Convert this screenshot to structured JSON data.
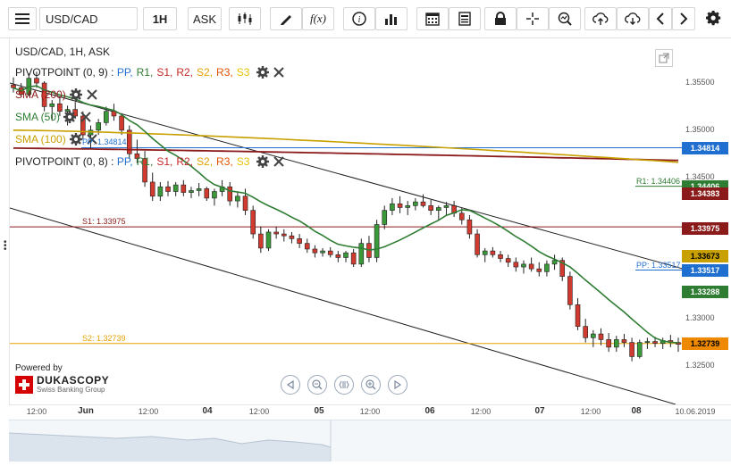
{
  "toolbar": {
    "symbol": "USD/CAD",
    "period": "1H",
    "side": "ASK"
  },
  "chart": {
    "title": "USD/CAD, 1H, ASK",
    "legend": [
      {
        "label": "PIVOTPOINT (0, 9)",
        "levels": [
          {
            "text": "PP,",
            "color": "#1f6fd1"
          },
          {
            "text": "R1,",
            "color": "#2e7d32"
          },
          {
            "text": "S1,",
            "color": "#c62828"
          },
          {
            "text": "R2,",
            "color": "#c62828"
          },
          {
            "text": "S2,",
            "color": "#e6a100"
          },
          {
            "text": "R3,",
            "color": "#e65100"
          },
          {
            "text": "S3",
            "color": "#e6c200"
          }
        ]
      },
      {
        "label": "SMA (200)",
        "color": "#8b1a1a"
      },
      {
        "label": "SMA (50)",
        "color": "#2e7d32"
      },
      {
        "label": "SMA (100)",
        "color": "#c8a000"
      },
      {
        "label": "PIVOTPOINT (0, 8)",
        "levels": [
          {
            "text": "PP,",
            "color": "#1f6fd1"
          },
          {
            "text": "R1,",
            "color": "#2e7d32"
          },
          {
            "text": "S1,",
            "color": "#c62828"
          },
          {
            "text": "R2,",
            "color": "#c62828"
          },
          {
            "text": "S2,",
            "color": "#e6a100"
          },
          {
            "text": "R3,",
            "color": "#e65100"
          },
          {
            "text": "S3",
            "color": "#e6c200"
          }
        ]
      }
    ],
    "line_labels": {
      "pp": "PP: 1.34814",
      "r1": "R1: 1.34406",
      "s1": "S1: 1.33975",
      "pp2": "PP: 1.33517",
      "s2": "S2: 1.32739"
    },
    "price_axis": [
      "1.35500",
      "1.35000",
      "1.34500",
      "1.33000",
      "1.32500"
    ],
    "price_tags": [
      {
        "text": "1.34814",
        "bg": "#1f6fd1",
        "fg": "#ffffff"
      },
      {
        "text": "1.34406",
        "bg": "#2e7d32",
        "fg": "#ffffff"
      },
      {
        "text": "1.34383",
        "bg": "#8b1a1a",
        "fg": "#ffffff"
      },
      {
        "text": "1.33975",
        "bg": "#8b1a1a",
        "fg": "#ffffff"
      },
      {
        "text": "1.33673",
        "bg": "#c8a000",
        "fg": "#000000"
      },
      {
        "text": "1.33517",
        "bg": "#1f6fd1",
        "fg": "#ffffff"
      },
      {
        "text": "1.33288",
        "bg": "#2e7d32",
        "fg": "#ffffff"
      },
      {
        "text": "1.32739",
        "bg": "#ef8a00",
        "fg": "#000000"
      }
    ],
    "time_axis": [
      {
        "text": "12:00",
        "bold": false
      },
      {
        "text": "Jun",
        "bold": true
      },
      {
        "text": "12:00",
        "bold": false
      },
      {
        "text": "04",
        "bold": true
      },
      {
        "text": "12:00",
        "bold": false
      },
      {
        "text": "05",
        "bold": true
      },
      {
        "text": "12:00",
        "bold": false
      },
      {
        "text": "06",
        "bold": true
      },
      {
        "text": "12:00",
        "bold": false
      },
      {
        "text": "07",
        "bold": true
      },
      {
        "text": "12:00",
        "bold": false
      },
      {
        "text": "08",
        "bold": true
      },
      {
        "text": "10.06.2019",
        "bold": false
      }
    ],
    "branding": {
      "powered_by": "Powered by",
      "name": "DUKASCOPY",
      "tagline": "Swiss Banking Group"
    },
    "candles": [
      [
        1.3548,
        1.3556,
        1.354,
        1.3545
      ],
      [
        1.3545,
        1.355,
        1.3535,
        1.3538
      ],
      [
        1.3538,
        1.356,
        1.3536,
        1.3555
      ],
      [
        1.3555,
        1.3562,
        1.3545,
        1.355
      ],
      [
        1.355,
        1.3552,
        1.352,
        1.3525
      ],
      [
        1.3525,
        1.3532,
        1.351,
        1.3528
      ],
      [
        1.3528,
        1.3535,
        1.3515,
        1.352
      ],
      [
        1.352,
        1.3526,
        1.3505,
        1.3522
      ],
      [
        1.3522,
        1.353,
        1.3512,
        1.3515
      ],
      [
        1.3515,
        1.352,
        1.349,
        1.3495
      ],
      [
        1.3495,
        1.3505,
        1.348,
        1.35
      ],
      [
        1.35,
        1.3512,
        1.3495,
        1.3508
      ],
      [
        1.3508,
        1.3525,
        1.3505,
        1.352
      ],
      [
        1.352,
        1.3528,
        1.351,
        1.3515
      ],
      [
        1.3515,
        1.3518,
        1.3495,
        1.35
      ],
      [
        1.35,
        1.3505,
        1.347,
        1.3475
      ],
      [
        1.3475,
        1.349,
        1.3465,
        1.347
      ],
      [
        1.347,
        1.3478,
        1.344,
        1.3445
      ],
      [
        1.3445,
        1.3455,
        1.3425,
        1.343
      ],
      [
        1.343,
        1.3445,
        1.3425,
        1.344
      ],
      [
        1.344,
        1.3446,
        1.343,
        1.3435
      ],
      [
        1.3435,
        1.3445,
        1.343,
        1.3442
      ],
      [
        1.3442,
        1.3447,
        1.343,
        1.3434
      ],
      [
        1.3434,
        1.344,
        1.3428,
        1.3436
      ],
      [
        1.3436,
        1.3444,
        1.343,
        1.3438
      ],
      [
        1.3438,
        1.344,
        1.3425,
        1.3428
      ],
      [
        1.3428,
        1.3438,
        1.342,
        1.3435
      ],
      [
        1.3435,
        1.3447,
        1.343,
        1.344
      ],
      [
        1.344,
        1.3445,
        1.342,
        1.3425
      ],
      [
        1.3425,
        1.3435,
        1.3418,
        1.343
      ],
      [
        1.343,
        1.3438,
        1.341,
        1.3415
      ],
      [
        1.3415,
        1.342,
        1.3385,
        1.339
      ],
      [
        1.339,
        1.3398,
        1.337,
        1.3375
      ],
      [
        1.3375,
        1.3395,
        1.3372,
        1.3392
      ],
      [
        1.3392,
        1.3398,
        1.3385,
        1.339
      ],
      [
        1.339,
        1.3395,
        1.3382,
        1.3388
      ],
      [
        1.3388,
        1.3392,
        1.338,
        1.3385
      ],
      [
        1.3385,
        1.339,
        1.3375,
        1.338
      ],
      [
        1.338,
        1.3385,
        1.337,
        1.3374
      ],
      [
        1.3374,
        1.3378,
        1.3365,
        1.337
      ],
      [
        1.337,
        1.3375,
        1.3366,
        1.3372
      ],
      [
        1.3372,
        1.3376,
        1.3365,
        1.3368
      ],
      [
        1.3368,
        1.3372,
        1.336,
        1.3365
      ],
      [
        1.3365,
        1.3372,
        1.336,
        1.337
      ],
      [
        1.337,
        1.3374,
        1.3355,
        1.3358
      ],
      [
        1.3358,
        1.3385,
        1.3355,
        1.338
      ],
      [
        1.338,
        1.3388,
        1.336,
        1.3365
      ],
      [
        1.3365,
        1.3405,
        1.336,
        1.34
      ],
      [
        1.34,
        1.342,
        1.3395,
        1.3415
      ],
      [
        1.3415,
        1.3428,
        1.341,
        1.3422
      ],
      [
        1.3422,
        1.343,
        1.3412,
        1.3418
      ],
      [
        1.3418,
        1.3425,
        1.341,
        1.342
      ],
      [
        1.342,
        1.3428,
        1.3415,
        1.3424
      ],
      [
        1.3424,
        1.3432,
        1.3418,
        1.342
      ],
      [
        1.342,
        1.3426,
        1.341,
        1.3415
      ],
      [
        1.3415,
        1.342,
        1.3405,
        1.3418
      ],
      [
        1.3418,
        1.3424,
        1.341,
        1.342
      ],
      [
        1.342,
        1.3425,
        1.3408,
        1.3412
      ],
      [
        1.3412,
        1.3418,
        1.34,
        1.3405
      ],
      [
        1.3405,
        1.341,
        1.3385,
        1.339
      ],
      [
        1.339,
        1.3395,
        1.3365,
        1.3368
      ],
      [
        1.3368,
        1.3375,
        1.336,
        1.3372
      ],
      [
        1.3372,
        1.3376,
        1.3365,
        1.3368
      ],
      [
        1.3368,
        1.3372,
        1.336,
        1.3364
      ],
      [
        1.3364,
        1.3368,
        1.3355,
        1.336
      ],
      [
        1.336,
        1.3365,
        1.335,
        1.3355
      ],
      [
        1.3355,
        1.3362,
        1.3348,
        1.3358
      ],
      [
        1.3358,
        1.3365,
        1.335,
        1.3353
      ],
      [
        1.3353,
        1.336,
        1.3345,
        1.335
      ],
      [
        1.335,
        1.3362,
        1.3345,
        1.3358
      ],
      [
        1.3358,
        1.3368,
        1.3352,
        1.3362
      ],
      [
        1.3362,
        1.3365,
        1.334,
        1.3345
      ],
      [
        1.3345,
        1.335,
        1.331,
        1.3315
      ],
      [
        1.3315,
        1.3322,
        1.3288,
        1.3292
      ],
      [
        1.3292,
        1.33,
        1.3275,
        1.328
      ],
      [
        1.328,
        1.3288,
        1.327,
        1.3284
      ],
      [
        1.3284,
        1.329,
        1.3272,
        1.3278
      ],
      [
        1.3278,
        1.3285,
        1.3265,
        1.327
      ],
      [
        1.327,
        1.3282,
        1.3265,
        1.3278
      ],
      [
        1.3278,
        1.3284,
        1.327,
        1.3275
      ],
      [
        1.3275,
        1.328,
        1.3255,
        1.326
      ],
      [
        1.326,
        1.3278,
        1.3258,
        1.3275
      ],
      [
        1.3275,
        1.328,
        1.3268,
        1.3276
      ],
      [
        1.3276,
        1.3281,
        1.327,
        1.3274
      ],
      [
        1.3274,
        1.328,
        1.3268,
        1.3277
      ],
      [
        1.3277,
        1.3283,
        1.327,
        1.3275
      ],
      [
        1.3275,
        1.328,
        1.3265,
        1.3273
      ]
    ]
  }
}
